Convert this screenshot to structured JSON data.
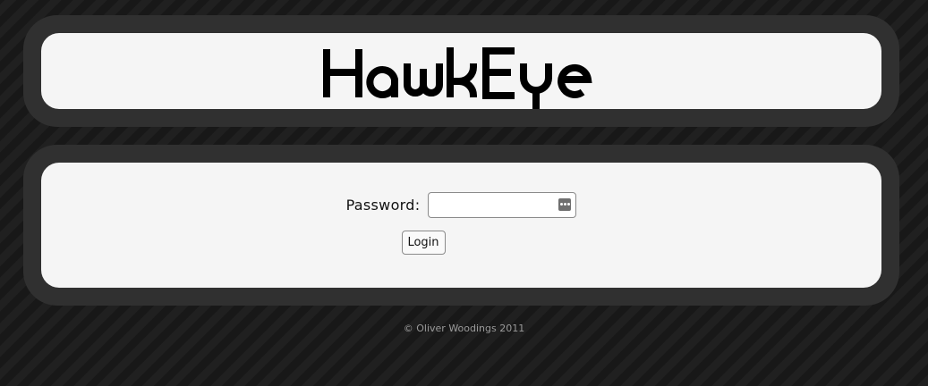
{
  "header": {
    "logo_text": "HawkEye"
  },
  "login": {
    "password_label": "Password:",
    "password_value": "",
    "login_button": "Login",
    "password_manager_icon": "key-dots-icon"
  },
  "footer": {
    "copyright": "© Oliver Woodings 2011"
  },
  "colors": {
    "background": "#1c1c1c",
    "frame": "#303030",
    "panel": "#f5f5f5",
    "logo": "#000000",
    "footer_text": "#9a9a9a"
  }
}
